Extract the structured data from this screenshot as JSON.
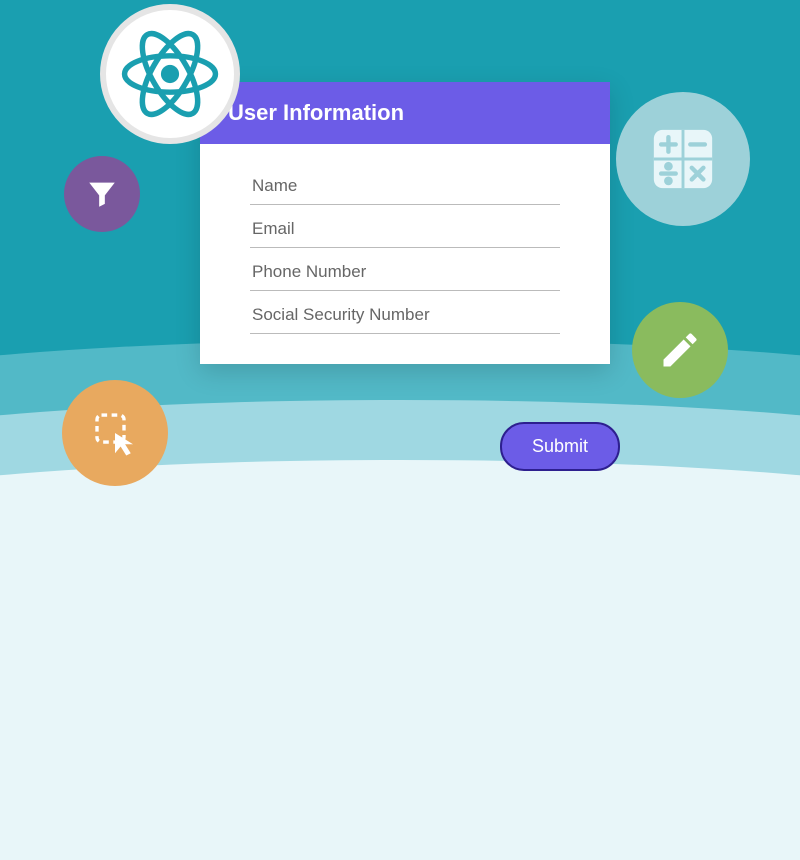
{
  "form": {
    "title": "User Information",
    "fields": {
      "name": {
        "placeholder": "Name"
      },
      "email": {
        "placeholder": "Email"
      },
      "phone": {
        "placeholder": "Phone Number"
      },
      "ssn": {
        "placeholder": "Social Security Number"
      }
    },
    "submit_label": "Submit"
  },
  "icons": {
    "react": "react-icon",
    "funnel": "funnel-icon",
    "calculator": "calculator-icon",
    "pencil": "pencil-icon",
    "selection": "selection-cursor-icon"
  },
  "colors": {
    "accent": "#6c5ce7",
    "teal": "#1a9fb0",
    "purple_circle": "#7a589c",
    "calc_circle": "#9dd1d9",
    "pencil_circle": "#8abb5e",
    "select_circle": "#e8a95f"
  }
}
